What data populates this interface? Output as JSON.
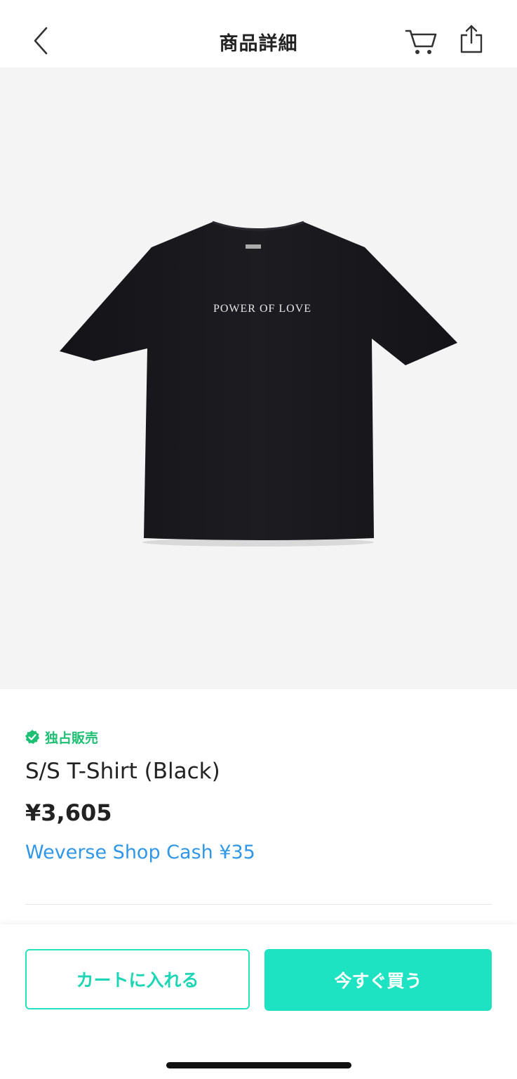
{
  "header": {
    "title": "商品詳細"
  },
  "product": {
    "image_print_text": "POWER OF LOVE",
    "badge": "独占販売",
    "name": "S/S T-Shirt (Black)",
    "price": "¥3,605",
    "cash": "Weverse Shop Cash ¥35"
  },
  "actions": {
    "add_to_cart": "カートに入れる",
    "buy_now": "今すぐ買う"
  },
  "icons": {
    "back": "chevron-left-icon",
    "cart": "cart-icon",
    "share": "share-icon",
    "badge": "verified-check-icon"
  },
  "colors": {
    "accent": "#1ee3c2",
    "badge_green": "#1dbf73",
    "cash_blue": "#2f97e6",
    "image_bg": "#f4f4f4"
  }
}
